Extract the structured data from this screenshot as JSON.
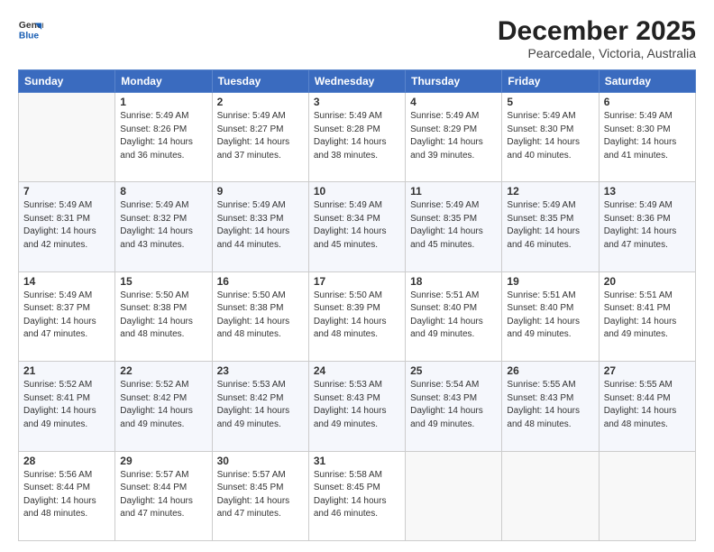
{
  "header": {
    "logo_line1": "General",
    "logo_line2": "Blue",
    "title": "December 2025",
    "subtitle": "Pearcedale, Victoria, Australia"
  },
  "calendar": {
    "days_of_week": [
      "Sunday",
      "Monday",
      "Tuesday",
      "Wednesday",
      "Thursday",
      "Friday",
      "Saturday"
    ],
    "weeks": [
      [
        {
          "day": "",
          "info": ""
        },
        {
          "day": "1",
          "info": "Sunrise: 5:49 AM\nSunset: 8:26 PM\nDaylight: 14 hours\nand 36 minutes."
        },
        {
          "day": "2",
          "info": "Sunrise: 5:49 AM\nSunset: 8:27 PM\nDaylight: 14 hours\nand 37 minutes."
        },
        {
          "day": "3",
          "info": "Sunrise: 5:49 AM\nSunset: 8:28 PM\nDaylight: 14 hours\nand 38 minutes."
        },
        {
          "day": "4",
          "info": "Sunrise: 5:49 AM\nSunset: 8:29 PM\nDaylight: 14 hours\nand 39 minutes."
        },
        {
          "day": "5",
          "info": "Sunrise: 5:49 AM\nSunset: 8:30 PM\nDaylight: 14 hours\nand 40 minutes."
        },
        {
          "day": "6",
          "info": "Sunrise: 5:49 AM\nSunset: 8:30 PM\nDaylight: 14 hours\nand 41 minutes."
        }
      ],
      [
        {
          "day": "7",
          "info": "Sunrise: 5:49 AM\nSunset: 8:31 PM\nDaylight: 14 hours\nand 42 minutes."
        },
        {
          "day": "8",
          "info": "Sunrise: 5:49 AM\nSunset: 8:32 PM\nDaylight: 14 hours\nand 43 minutes."
        },
        {
          "day": "9",
          "info": "Sunrise: 5:49 AM\nSunset: 8:33 PM\nDaylight: 14 hours\nand 44 minutes."
        },
        {
          "day": "10",
          "info": "Sunrise: 5:49 AM\nSunset: 8:34 PM\nDaylight: 14 hours\nand 45 minutes."
        },
        {
          "day": "11",
          "info": "Sunrise: 5:49 AM\nSunset: 8:35 PM\nDaylight: 14 hours\nand 45 minutes."
        },
        {
          "day": "12",
          "info": "Sunrise: 5:49 AM\nSunset: 8:35 PM\nDaylight: 14 hours\nand 46 minutes."
        },
        {
          "day": "13",
          "info": "Sunrise: 5:49 AM\nSunset: 8:36 PM\nDaylight: 14 hours\nand 47 minutes."
        }
      ],
      [
        {
          "day": "14",
          "info": "Sunrise: 5:49 AM\nSunset: 8:37 PM\nDaylight: 14 hours\nand 47 minutes."
        },
        {
          "day": "15",
          "info": "Sunrise: 5:50 AM\nSunset: 8:38 PM\nDaylight: 14 hours\nand 48 minutes."
        },
        {
          "day": "16",
          "info": "Sunrise: 5:50 AM\nSunset: 8:38 PM\nDaylight: 14 hours\nand 48 minutes."
        },
        {
          "day": "17",
          "info": "Sunrise: 5:50 AM\nSunset: 8:39 PM\nDaylight: 14 hours\nand 48 minutes."
        },
        {
          "day": "18",
          "info": "Sunrise: 5:51 AM\nSunset: 8:40 PM\nDaylight: 14 hours\nand 49 minutes."
        },
        {
          "day": "19",
          "info": "Sunrise: 5:51 AM\nSunset: 8:40 PM\nDaylight: 14 hours\nand 49 minutes."
        },
        {
          "day": "20",
          "info": "Sunrise: 5:51 AM\nSunset: 8:41 PM\nDaylight: 14 hours\nand 49 minutes."
        }
      ],
      [
        {
          "day": "21",
          "info": "Sunrise: 5:52 AM\nSunset: 8:41 PM\nDaylight: 14 hours\nand 49 minutes."
        },
        {
          "day": "22",
          "info": "Sunrise: 5:52 AM\nSunset: 8:42 PM\nDaylight: 14 hours\nand 49 minutes."
        },
        {
          "day": "23",
          "info": "Sunrise: 5:53 AM\nSunset: 8:42 PM\nDaylight: 14 hours\nand 49 minutes."
        },
        {
          "day": "24",
          "info": "Sunrise: 5:53 AM\nSunset: 8:43 PM\nDaylight: 14 hours\nand 49 minutes."
        },
        {
          "day": "25",
          "info": "Sunrise: 5:54 AM\nSunset: 8:43 PM\nDaylight: 14 hours\nand 49 minutes."
        },
        {
          "day": "26",
          "info": "Sunrise: 5:55 AM\nSunset: 8:43 PM\nDaylight: 14 hours\nand 48 minutes."
        },
        {
          "day": "27",
          "info": "Sunrise: 5:55 AM\nSunset: 8:44 PM\nDaylight: 14 hours\nand 48 minutes."
        }
      ],
      [
        {
          "day": "28",
          "info": "Sunrise: 5:56 AM\nSunset: 8:44 PM\nDaylight: 14 hours\nand 48 minutes."
        },
        {
          "day": "29",
          "info": "Sunrise: 5:57 AM\nSunset: 8:44 PM\nDaylight: 14 hours\nand 47 minutes."
        },
        {
          "day": "30",
          "info": "Sunrise: 5:57 AM\nSunset: 8:45 PM\nDaylight: 14 hours\nand 47 minutes."
        },
        {
          "day": "31",
          "info": "Sunrise: 5:58 AM\nSunset: 8:45 PM\nDaylight: 14 hours\nand 46 minutes."
        },
        {
          "day": "",
          "info": ""
        },
        {
          "day": "",
          "info": ""
        },
        {
          "day": "",
          "info": ""
        }
      ]
    ]
  }
}
